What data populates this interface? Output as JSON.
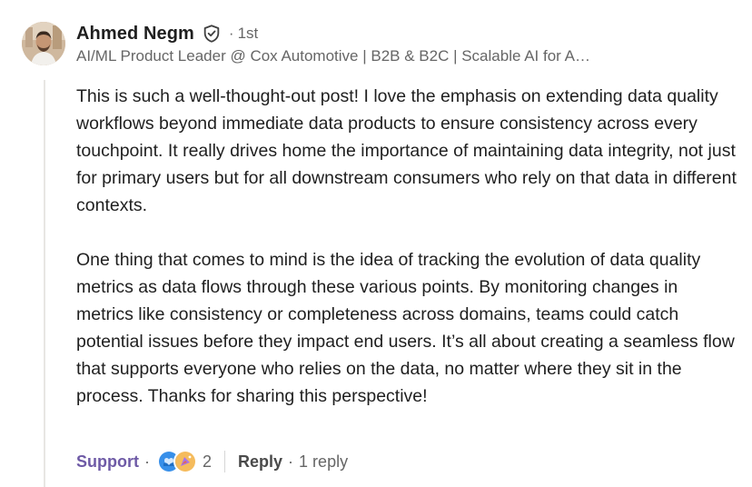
{
  "comment": {
    "author": {
      "name": "Ahmed Negm",
      "degree": "1st",
      "separator": "·",
      "headline": "AI/ML Product Leader @ Cox Automotive | B2B & B2C | Scalable AI for A…"
    },
    "paragraphs": [
      "This is such a well-thought-out post! I love the emphasis on extending data quality workflows beyond immediate data products to ensure consistency across every touchpoint. It really drives home the importance of maintaining data integrity, not just for primary users but for all downstream consumers who rely on that data in different contexts.",
      "One thing that comes to mind is the idea of tracking the evolution of data quality metrics as data flows through these various points. By monitoring changes in metrics like consistency or completeness across domains, teams could catch potential issues before they impact end users. It’s all about creating a seamless flow that supports everyone who relies on the data, no matter where they sit in the process. Thanks for sharing this perspective!"
    ],
    "actions": {
      "support_label": "Support",
      "dot": "·",
      "reaction_count": "2",
      "reply_label": "Reply",
      "reply_count": "1 reply"
    }
  },
  "icons": {
    "verified": "shield-check-icon",
    "reactions": [
      "support-heart-icon",
      "celebrate-icon"
    ]
  },
  "colors": {
    "support_accent": "#6e5aa6",
    "text_primary": "#1f1f1f",
    "text_secondary": "#666666",
    "thread_line": "#e8e6e3"
  }
}
